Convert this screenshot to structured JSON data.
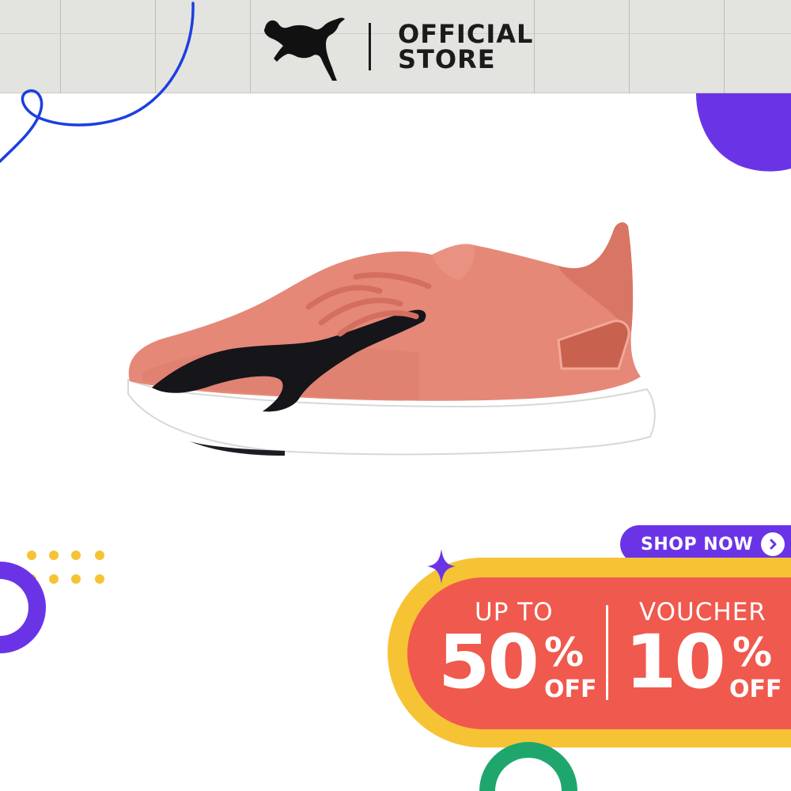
{
  "header": {
    "brand_icon": "puma-cat-logo",
    "store_line1": "OFFICIAL",
    "store_line2": "STORE"
  },
  "product": {
    "image": "pink-puma-running-shoe"
  },
  "promo": {
    "shop_button_label": "SHOP NOW",
    "shop_button_icon": "chevron-right-icon",
    "left_label": "UP TO",
    "left_value": "50",
    "left_percent": "%",
    "left_suffix": "OFF",
    "right_label": "VOUCHER",
    "right_value": "10",
    "right_percent": "%",
    "right_suffix": "OFF"
  },
  "colors": {
    "header_bg": "#e3e3e0",
    "purple": "#6a34e6",
    "yellow": "#f6c335",
    "red": "#f0594d",
    "green": "#1fa66d",
    "blue_line": "#1c3fe0"
  }
}
